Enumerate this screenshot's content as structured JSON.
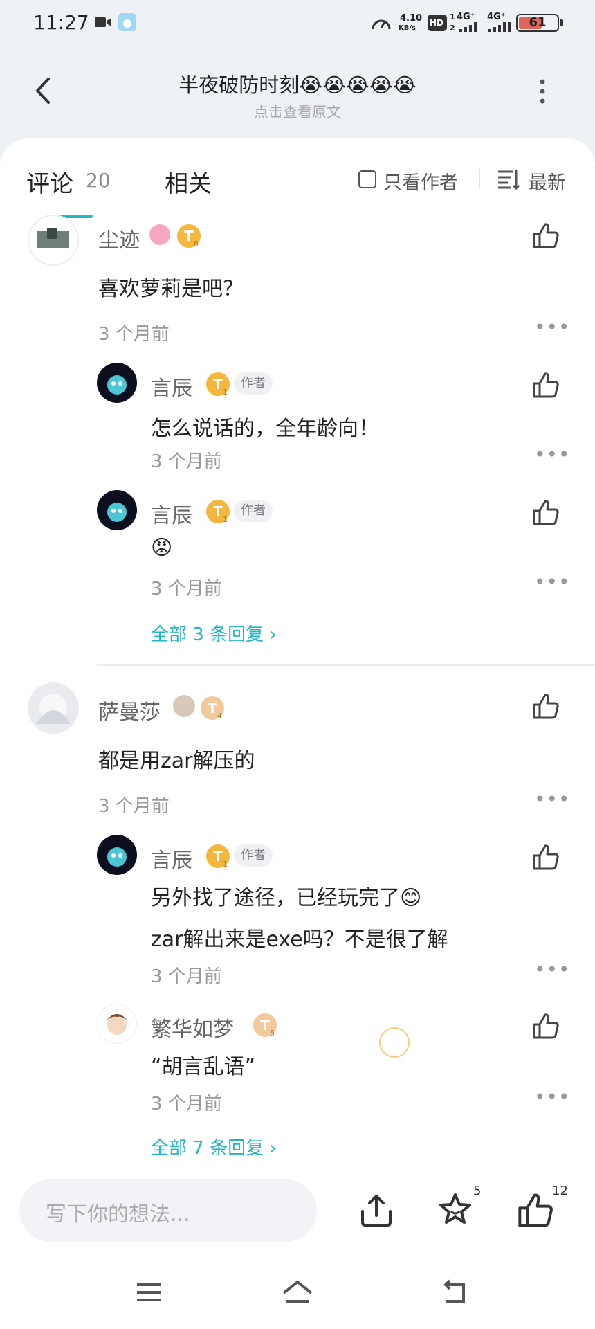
{
  "status_bar": {
    "time": "11:27",
    "speed": "4.10",
    "speed_unit": "KB/s",
    "network1": "4G⁺",
    "network2": "4G⁺",
    "hd": "HD",
    "hd_sub": "2",
    "hd_sup": "1",
    "battery": "61",
    "battery_level": 0.61
  },
  "header": {
    "title": "半夜破防时刻😭😭😭😭😭",
    "subtitle": "点击查看原文"
  },
  "tabs": {
    "comments_label": "评论",
    "comments_count": "20",
    "related_label": "相关",
    "author_only": "只看作者",
    "sort": "最新"
  },
  "comments": [
    {
      "user": "尘迹",
      "badge": "T",
      "badge_level": "8",
      "text": "喜欢萝莉是吧？",
      "time": "3 个月前",
      "replies": [
        {
          "user": "言辰",
          "badge": "T",
          "badge_level": "1",
          "author_tag": "作者",
          "text": "怎么说话的，全年龄向！",
          "time": "3 个月前"
        },
        {
          "user": "言辰",
          "badge": "T",
          "badge_level": "1",
          "author_tag": "作者",
          "text": "😡",
          "time": "3 个月前"
        }
      ],
      "all_replies": "全部 3 条回复 ›"
    },
    {
      "user": "萨曼莎",
      "badge": "T",
      "badge_level": "4",
      "text": "都是用zar解压的",
      "time": "3 个月前",
      "replies": [
        {
          "user": "言辰",
          "badge": "T",
          "badge_level": "1",
          "author_tag": "作者",
          "text": "另外找了途径，已经玩完了😊",
          "text2": "zar解出来是exe吗？不是很了解",
          "time": "3 个月前"
        },
        {
          "user": "繁华如梦",
          "badge": "T",
          "badge_level": "5",
          "text": "“胡言乱语”",
          "time": "3 个月前"
        }
      ],
      "all_replies": "全部 7 条回复 ›"
    }
  ],
  "bottom": {
    "input_placeholder": "写下你的想法...",
    "favorite_count": "5",
    "like_count": "12"
  },
  "colors": {
    "accent": "#23b6c4",
    "badge_gold": "#f4b63c",
    "background": "#eef1f6"
  }
}
